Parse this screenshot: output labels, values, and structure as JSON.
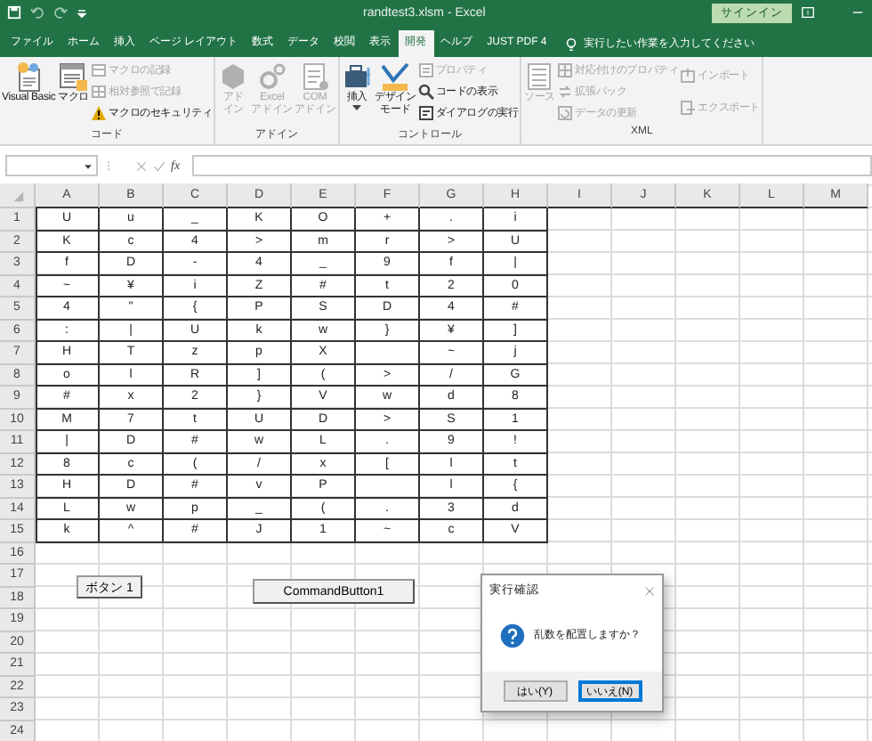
{
  "window": {
    "title": "randtest3.xlsm - Excel",
    "signin": "サインイン"
  },
  "tabs": [
    {
      "label": "ファイル",
      "selected": false
    },
    {
      "label": "ホーム",
      "selected": false
    },
    {
      "label": "挿入",
      "selected": false
    },
    {
      "label": "ページ レイアウト",
      "selected": false
    },
    {
      "label": "数式",
      "selected": false
    },
    {
      "label": "データ",
      "selected": false
    },
    {
      "label": "校閲",
      "selected": false
    },
    {
      "label": "表示",
      "selected": false
    },
    {
      "label": "開発",
      "selected": true
    },
    {
      "label": "ヘルプ",
      "selected": false
    },
    {
      "label": "JUST PDF 4",
      "selected": false
    }
  ],
  "tell_me": {
    "placeholder": "実行したい作業を入力してください"
  },
  "ribbon": {
    "groups": [
      {
        "label": "コード",
        "items": [
          {
            "kind": "large",
            "lines": [
              "Visual Basic"
            ],
            "disabled": false
          },
          {
            "kind": "large",
            "lines": [
              "マクロ"
            ],
            "disabled": false
          },
          {
            "kind": "stack",
            "items": [
              {
                "label": "マクロの記録",
                "disabled": true
              },
              {
                "label": "相対参照で記録",
                "disabled": true
              },
              {
                "label": "マクロのセキュリティ",
                "disabled": false
              }
            ]
          }
        ]
      },
      {
        "label": "アドイン",
        "items": [
          {
            "kind": "large",
            "lines": [
              "アド",
              "イン"
            ],
            "disabled": true
          },
          {
            "kind": "large",
            "lines": [
              "Excel",
              "アドイン"
            ],
            "disabled": true
          },
          {
            "kind": "large",
            "lines": [
              "COM",
              "アドイン"
            ],
            "disabled": true
          }
        ]
      },
      {
        "label": "コントロール",
        "items": [
          {
            "kind": "large",
            "lines": [
              "挿入"
            ],
            "dropdown": true,
            "disabled": false
          },
          {
            "kind": "large",
            "lines": [
              "デザイン",
              "モード"
            ],
            "disabled": false
          },
          {
            "kind": "stack",
            "items": [
              {
                "label": "プロパティ",
                "disabled": true
              },
              {
                "label": "コードの表示",
                "disabled": false
              },
              {
                "label": "ダイアログの実行",
                "disabled": false
              }
            ]
          }
        ]
      },
      {
        "label": "XML",
        "items": [
          {
            "kind": "large",
            "lines": [
              "ソース"
            ],
            "disabled": true
          },
          {
            "kind": "stack",
            "items": [
              {
                "label": "対応付けのプロパティ",
                "disabled": true
              },
              {
                "label": "拡張パック",
                "disabled": true
              },
              {
                "label": "データの更新",
                "disabled": true
              }
            ]
          },
          {
            "kind": "stack",
            "items": [
              {
                "label": "インポート",
                "disabled": true
              },
              {
                "label": "エクスポート",
                "disabled": true
              }
            ]
          }
        ]
      }
    ]
  },
  "formula_bar": {
    "function_label": "fx"
  },
  "sheet": {
    "columns": [
      "A",
      "B",
      "C",
      "D",
      "E",
      "F",
      "G",
      "H",
      "I",
      "J",
      "K",
      "L",
      "M"
    ],
    "row_numbers": [
      "1",
      "2",
      "3",
      "4",
      "5",
      "6",
      "7",
      "8",
      "9",
      "10",
      "11",
      "12",
      "13",
      "14",
      "15",
      "16",
      "17",
      "18",
      "19",
      "20",
      "21",
      "22",
      "23",
      "24"
    ],
    "cells": [
      [
        "U",
        "u",
        "_",
        "K",
        "O",
        "+",
        ".",
        "i"
      ],
      [
        "K",
        "c",
        "4",
        ">",
        "m",
        "r",
        ">",
        "U"
      ],
      [
        "f",
        "D",
        "-",
        "4",
        "_",
        "9",
        "f",
        "|"
      ],
      [
        "~",
        "¥",
        "i",
        "Z",
        "#",
        "t",
        "2",
        "0"
      ],
      [
        "4",
        "\"",
        "{",
        "P",
        "S",
        "D",
        "4",
        "#"
      ],
      [
        ":",
        "|",
        "U",
        "k",
        "w",
        "}",
        "¥",
        "]"
      ],
      [
        "H",
        "T",
        "z",
        "p",
        "X",
        "",
        "~",
        "j"
      ],
      [
        "o",
        "l",
        "R",
        "]",
        "(",
        ">",
        "/",
        "G"
      ],
      [
        "#",
        "x",
        "2",
        "}",
        "V",
        "w",
        "d",
        "8"
      ],
      [
        "M",
        "7",
        "t",
        "U",
        "D",
        ">",
        "S",
        "1"
      ],
      [
        "|",
        "D",
        "#",
        "w",
        "L",
        ".",
        "9",
        "!"
      ],
      [
        "8",
        "c",
        "(",
        "/",
        "x",
        "[",
        "l",
        "t"
      ],
      [
        "H",
        "D",
        "#",
        "v",
        "P",
        "",
        "l",
        "{"
      ],
      [
        "L",
        "w",
        "p",
        "_",
        "(",
        ".",
        "3",
        "d"
      ],
      [
        "k",
        "^",
        "#",
        "J",
        "1",
        "~",
        "c",
        "V"
      ]
    ]
  },
  "sheet_buttons": [
    {
      "label": "ボタン 1"
    },
    {
      "label": "CommandButton1"
    }
  ],
  "dialog": {
    "title": "実行確認",
    "message": "乱数を配置しますか？",
    "buttons": [
      {
        "label": "はい(Y)",
        "selected": false
      },
      {
        "label": "いいえ(N)",
        "selected": true
      }
    ]
  }
}
